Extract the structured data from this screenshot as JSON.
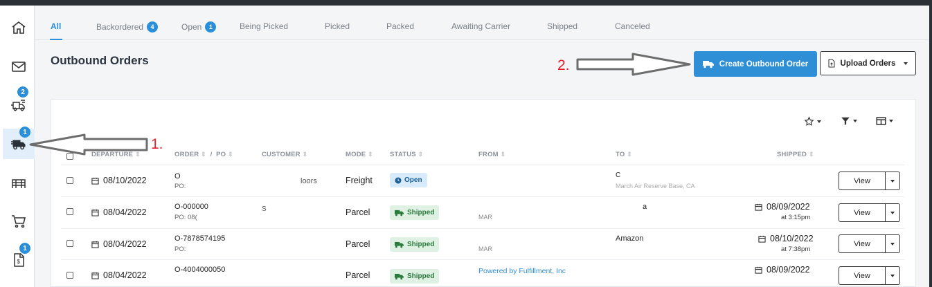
{
  "tabs": [
    {
      "label": "All"
    },
    {
      "label": "Backordered",
      "badge": "4"
    },
    {
      "label": "Open",
      "badge": "1"
    },
    {
      "label": "Being Picked"
    },
    {
      "label": "Picked"
    },
    {
      "label": "Packed"
    },
    {
      "label": "Awaiting Carrier"
    },
    {
      "label": "Shipped"
    },
    {
      "label": "Canceled"
    }
  ],
  "sidebar": {
    "badges": {
      "inbound": "2",
      "outbound": "1",
      "billing": "1"
    }
  },
  "page": {
    "title": "Outbound Orders",
    "create_label": "Create Outbound Order",
    "upload_label": "Upload Orders"
  },
  "table": {
    "headers": {
      "departure": "DEPARTURE",
      "order": "ORDER",
      "po": "PO",
      "customer": "CUSTOMER",
      "mode": "MODE",
      "status": "STATUS",
      "from": "FROM",
      "to": "TO",
      "shipped": "SHIPPED"
    },
    "view_label": "View",
    "rows": [
      {
        "departure": "08/10/2022",
        "order": "O",
        "po": "PO:",
        "customer": "loors",
        "mode": "Freight",
        "status": "Open",
        "from": "",
        "to": "C",
        "to_sub": "March Air Reserve Base, CA",
        "shipped_date": "",
        "shipped_time": ""
      },
      {
        "departure": "08/04/2022",
        "order": "O-000000",
        "po": "PO: 08(",
        "customer": "S",
        "mode": "Parcel",
        "status": "Shipped",
        "from": "MAR",
        "to": "a",
        "to_sub": "",
        "shipped_date": "08/09/2022",
        "shipped_time": "at 3:15pm"
      },
      {
        "departure": "08/04/2022",
        "order": "O-7878574195",
        "po": "PO:",
        "customer": "",
        "mode": "Parcel",
        "status": "Shipped",
        "from": "MAR",
        "to": "Amazon",
        "to_sub": "",
        "shipped_date": "08/10/2022",
        "shipped_time": "at 7:38pm"
      },
      {
        "departure": "08/04/2022",
        "order": "O-4004000050",
        "po": "",
        "customer": "",
        "mode": "Parcel",
        "status": "Shipped",
        "from": "Powered by Fulfillment, Inc",
        "to": "",
        "to_sub": "",
        "shipped_date": "08/09/2022",
        "shipped_time": ""
      }
    ]
  },
  "annotations": {
    "step1": "1.",
    "step2": "2."
  },
  "colors": {
    "accent": "#2e8fd6",
    "annotation": "#e0232a"
  }
}
